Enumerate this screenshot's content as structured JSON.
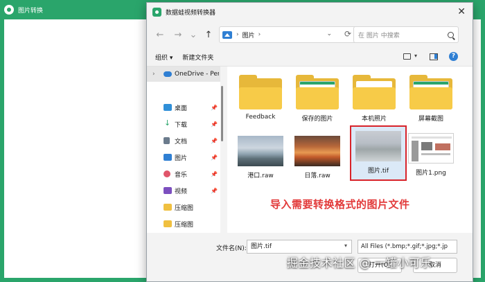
{
  "app": {
    "title": "图片转换"
  },
  "dialog": {
    "title": "数据蛙视频转换器",
    "close_glyph": "✕",
    "nav": {
      "back": "←",
      "forward": "→",
      "recent": "⌄",
      "up": "↑"
    },
    "address": {
      "separator": "›",
      "location": "图片",
      "trailing_separator": "›",
      "dropdown": "⌄",
      "refresh": "⟳"
    },
    "search": {
      "placeholder": "在 图片 中搜索"
    },
    "command_bar": {
      "organize": "组织 ▾",
      "new_folder": "新建文件夹",
      "view_dropdown": "▾",
      "help": "?"
    },
    "sidebar": {
      "chevron": "›",
      "pin_glyph": "📌",
      "items": [
        {
          "label": "OneDrive - Per",
          "icon": "cloud-icon",
          "pinned": false
        },
        {
          "label": "桌面",
          "icon": "desktop-icon",
          "pinned": true
        },
        {
          "label": "下载",
          "icon": "download-icon",
          "pinned": true
        },
        {
          "label": "文档",
          "icon": "document-icon",
          "pinned": true
        },
        {
          "label": "图片",
          "icon": "picture-icon",
          "pinned": true
        },
        {
          "label": "音乐",
          "icon": "music-icon",
          "pinned": true
        },
        {
          "label": "视频",
          "icon": "video-icon",
          "pinned": true
        },
        {
          "label": "压缩图",
          "icon": "folder-icon",
          "pinned": false
        },
        {
          "label": "压缩图",
          "icon": "folder-icon",
          "pinned": false
        }
      ]
    },
    "files": [
      {
        "name": "Feedback",
        "type": "folder"
      },
      {
        "name": "保存的图片",
        "type": "folder"
      },
      {
        "name": "本机照片",
        "type": "folder"
      },
      {
        "name": "屏幕截图",
        "type": "folder"
      },
      {
        "name": "港口.raw",
        "type": "image"
      },
      {
        "name": "日落.raw",
        "type": "image"
      },
      {
        "name": "图片.tif",
        "type": "image",
        "selected": true
      },
      {
        "name": "图片1.png",
        "type": "image"
      }
    ],
    "filename": {
      "label": "文件名(N):",
      "value": "图片.tif",
      "dropdown": "▾"
    },
    "filter": {
      "value": "All Files (*.bmp;*.gif;*.jpg;*.jp"
    },
    "buttons": {
      "open": "打开(O)",
      "cancel": "取消"
    }
  },
  "annotation": {
    "text": "导入需要转换格式的图片文件"
  },
  "watermark": {
    "text": "掘金技术社区 @ 一罐小可乐"
  },
  "colors": {
    "accent_green": "#2aa56b",
    "highlight_red": "#d8232a",
    "link_blue": "#2f7fd3"
  }
}
